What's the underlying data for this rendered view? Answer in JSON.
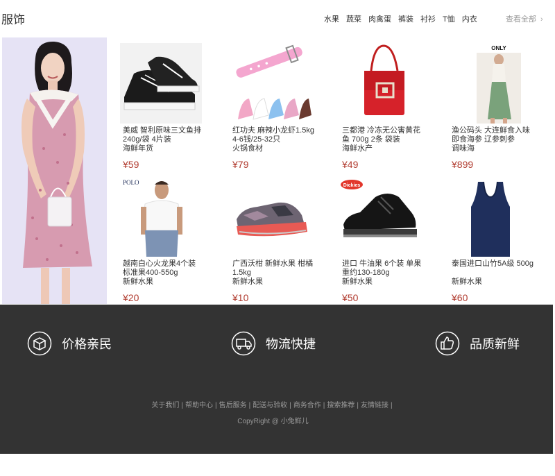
{
  "section": {
    "title": "服饰",
    "categories": [
      "水果",
      "蔬菜",
      "肉禽蛋",
      "裤装",
      "衬衫",
      "T恤",
      "内衣"
    ],
    "view_all": "查看全部"
  },
  "hero": {
    "image": "woman-in-pink-floral-dress"
  },
  "products": [
    {
      "name": "美威 智利原味三文鱼排\n240g/袋 4片装\n海鲜年货",
      "price": "¥59",
      "image": "black-platform-sneakers"
    },
    {
      "name": "红功夫 麻辣小龙虾1.5kg\n4-6钱/25-32只\n火锅食材",
      "price": "¥79",
      "image": "watch-straps"
    },
    {
      "name": "三都港 冷冻无公害黄花\n鱼 700g 2条 袋装\n海鲜水产",
      "price": "¥49",
      "image": "red-handbag"
    },
    {
      "name": "渔公码头 大连鲜食入味\n即食海参 辽参刺参\n调味海",
      "price": "¥899",
      "image": "only-brand-model",
      "logo_text": "ONLY"
    },
    {
      "name": "越南白心火龙果4个装\n标准果400-550g\n新鲜水果",
      "price": "¥20",
      "image": "polo-white-tshirt-model",
      "logo_text": "POLO"
    },
    {
      "name": "广西沃柑 新鲜水果 柑橘\n1.5kg\n新鲜水果",
      "price": "¥10",
      "image": "grey-running-shoe"
    },
    {
      "name": "进口 牛油果 6个装 单果\n重约130-180g\n新鲜水果",
      "price": "¥50",
      "image": "dickies-black-shoe",
      "logo_text": "Dickies"
    },
    {
      "name": "泰国进口山竹5A级 500g\n\n新鲜水果",
      "price": "¥60",
      "image": "navy-tank-top"
    }
  ],
  "footer": {
    "features": [
      {
        "label": "价格亲民",
        "icon": "box-icon"
      },
      {
        "label": "物流快捷",
        "icon": "truck-icon"
      },
      {
        "label": "品质新鲜",
        "icon": "thumbs-up-icon"
      }
    ],
    "links": [
      "关于我们",
      "帮助中心",
      "售后服务",
      "配送与验收",
      "商务合作",
      "搜索推荐",
      "友情链接"
    ],
    "copyright": "CopyRight @ 小兔鲜儿"
  },
  "colors": {
    "price": "#b03a2e",
    "footer_bg": "#333333",
    "hero_bg": "#e4e1f4"
  }
}
